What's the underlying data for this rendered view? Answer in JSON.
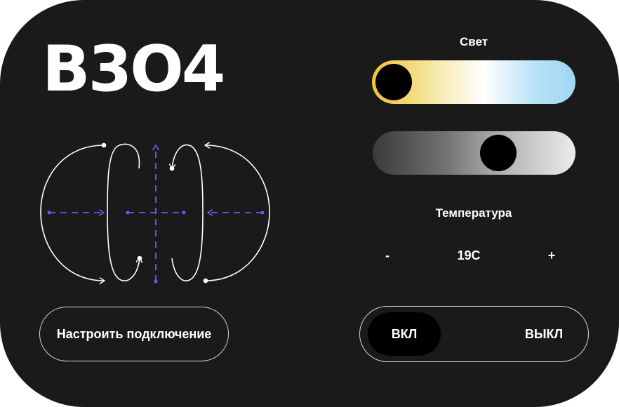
{
  "room": {
    "name": "B3O4"
  },
  "diagram": {
    "icon": "connection-field-icon",
    "line_color": "#ffffff",
    "accent_color": "#6a5cf0"
  },
  "connect_button": {
    "label": "Настроить подключение"
  },
  "light": {
    "label": "Свет",
    "color_temperature_level": 0.0,
    "brightness_level": 0.65,
    "warm_color": "#f3c232",
    "cool_color": "#9fd6f2"
  },
  "temperature": {
    "label": "Температура",
    "decrease_label": "-",
    "value": "19C",
    "increase_label": "+"
  },
  "power": {
    "on_label": "ВКЛ",
    "off_label": "ВЫКЛ",
    "selected": "ВКЛ"
  },
  "colors": {
    "panel_background": "#1a1a1a",
    "text": "#ffffff",
    "selected_segment": "#000000"
  }
}
